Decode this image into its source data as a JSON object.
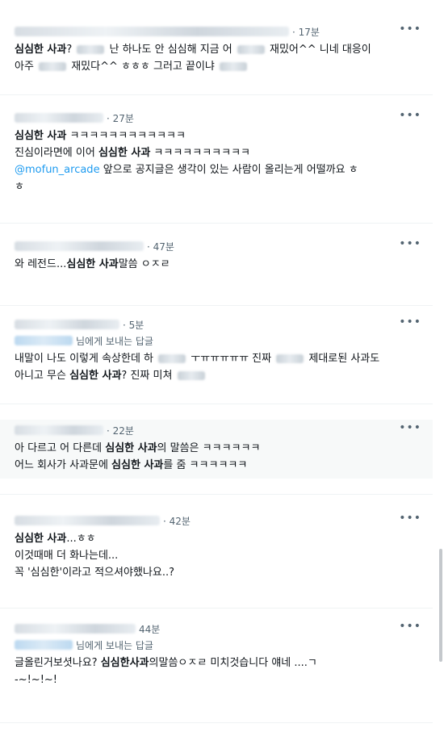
{
  "tweets": [
    {
      "time": "· 17분",
      "more_icon": "more-icon",
      "lines": [
        [
          {
            "t": "심심한 사과",
            "b": true
          },
          {
            "t": "? "
          },
          {
            "blur": true
          },
          {
            "t": " 난 하나도 안 심심해 지금 어 "
          },
          {
            "blur": true
          },
          {
            "t": " 재밌어^^ 니네 대응이"
          }
        ],
        [
          {
            "t": "아주 "
          },
          {
            "blur": true
          },
          {
            "t": " 재밌다^^ ㅎㅎㅎ 그러고 끝이냐 "
          },
          {
            "blur": true
          }
        ]
      ]
    },
    {
      "time": "· 27분",
      "lines": [
        [
          {
            "t": "심심한 사과",
            "b": true
          },
          {
            "t": " ㅋㅋㅋㅋㅋㅋㅋㅋㅋㅋㅋㅋ"
          }
        ],
        [
          {
            "t": "진심이라면에 이어 "
          },
          {
            "t": "심심한 사과",
            "b": true
          },
          {
            "t": " ㅋㅋㅋㅋㅋㅋㅋㅋㅋㅋ"
          }
        ],
        [
          {
            "t": "@mofun_arcade",
            "m": true
          },
          {
            "t": " 앞으로 공지글은 생각이 있는 사람이 올리는게 어떨까요 ㅎ"
          }
        ],
        [
          {
            "t": "ㅎ"
          }
        ]
      ]
    },
    {
      "time": "· 47분",
      "lines": [
        [
          {
            "t": "와 레전드..."
          },
          {
            "t": "심심한 사과",
            "b": true
          },
          {
            "t": "말씀 ㅇㅈㄹ"
          }
        ]
      ]
    },
    {
      "time": "· 5분",
      "reply_to": "님에게 보내는 답글",
      "lines": [
        [
          {
            "t": "내말이 나도 이렇게 속상한데 하 "
          },
          {
            "blur": true
          },
          {
            "t": " ㅜㅠㅠㅠㅠㅠ 진짜 "
          },
          {
            "blur": true
          },
          {
            "t": " 제대로된 사과도"
          }
        ],
        [
          {
            "t": "아니고 무슨 "
          },
          {
            "t": "심심한 사과",
            "b": true
          },
          {
            "t": "? 진짜 미쳐 "
          },
          {
            "blur": true
          }
        ]
      ]
    },
    {
      "time": "· 22분",
      "lines": [
        [
          {
            "t": "아 다르고 어 다른데 "
          },
          {
            "t": "심심한 사과",
            "b": true
          },
          {
            "t": "의 말씀은 ㅋㅋㅋㅋㅋㅋ"
          }
        ],
        [
          {
            "t": "어느 회사가 사과문에 "
          },
          {
            "t": "심심한 사과",
            "b": true
          },
          {
            "t": "를 줌 ㅋㅋㅋㅋㅋㅋ"
          }
        ]
      ]
    },
    {
      "time": "· 42분",
      "lines": [
        [
          {
            "t": "심심한 사과",
            "b": true
          },
          {
            "t": "...ㅎㅎ"
          }
        ],
        [
          {
            "t": "이것때매 더 화나는데..."
          }
        ],
        [
          {
            "t": "꼭 '심심한'이라고 적으셔야했나요..?"
          }
        ]
      ]
    },
    {
      "time": "44분",
      "reply_to": "님에게 보내는 답글",
      "lines": [
        [
          {
            "t": "글올린거보셧나요? "
          },
          {
            "t": "심심한사과",
            "b": true
          },
          {
            "t": "의말씀ㅇㅈㄹ 미치것습니다 얘네 ....ㄱ"
          }
        ],
        [
          {
            "t": "-~!~!~!"
          }
        ]
      ]
    }
  ]
}
